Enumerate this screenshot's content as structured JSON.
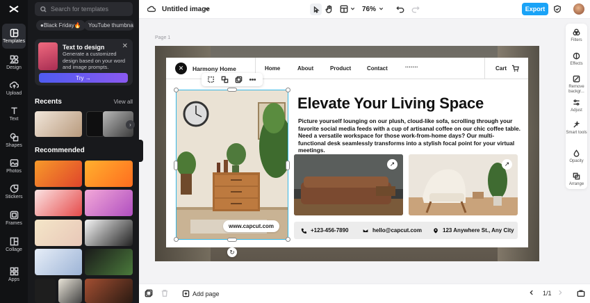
{
  "colors": {
    "accent": "#1aa3f7",
    "selection": "#35b7e6",
    "sidebar_bg": "#18191c",
    "rail_bg": "#111214"
  },
  "rail": {
    "items": [
      {
        "label": "Templates",
        "icon": "templates-icon"
      },
      {
        "label": "Design",
        "icon": "design-icon"
      },
      {
        "label": "Upload",
        "icon": "upload-icon"
      },
      {
        "label": "Text",
        "icon": "text-icon"
      },
      {
        "label": "Shapes",
        "icon": "shapes-icon"
      },
      {
        "label": "Photos",
        "icon": "photos-icon"
      },
      {
        "label": "Stickers",
        "icon": "stickers-icon"
      },
      {
        "label": "Frames",
        "icon": "frames-icon"
      },
      {
        "label": "Collage",
        "icon": "collage-icon"
      },
      {
        "label": "Apps",
        "icon": "apps-icon"
      }
    ]
  },
  "panel": {
    "search_placeholder": "Search for templates",
    "chips": [
      "●Black Friday🔥",
      "YouTube thumbna"
    ],
    "promo": {
      "title": "Text to design",
      "description": "Generate a customized design based on your word and image prompts.",
      "button": "Try →"
    },
    "recents_title": "Recents",
    "view_all": "View all",
    "recommended_title": "Recommended"
  },
  "topbar": {
    "doc_title": "Untitled image",
    "zoom": "76%",
    "export_label": "Export"
  },
  "canvas": {
    "page_label": "Page 1",
    "nav": {
      "brand": "Harmony Home",
      "links": [
        "Home",
        "About",
        "Product",
        "Contact",
        "·······"
      ],
      "cart": "Cart"
    },
    "headline": "Elevate Your Living Space",
    "body": "Picture yourself lounging on our plush, cloud-like sofa, scrolling through your favorite social media feeds with a cup of artisanal coffee on our chic coffee table. Need a versatile workspace for those work-from-home days? Our multi-functional desk seamlessly transforms into a stylish focal point for your virtual meetings.",
    "url": "www.capcut.com",
    "contacts": {
      "phone": "+123-456-7890",
      "email": "hello@capcut.com",
      "address": "123 Anywhere St., Any City"
    }
  },
  "tools": [
    {
      "label": "Filters",
      "icon": "filters-icon"
    },
    {
      "label": "Effects",
      "icon": "effects-icon"
    },
    {
      "label": "Remove backgr...",
      "icon": "remove-background-icon"
    },
    {
      "label": "Adjust",
      "icon": "adjust-icon"
    },
    {
      "label": "Smart tools",
      "icon": "smart-tools-icon"
    },
    {
      "label": "Opacity",
      "icon": "opacity-icon"
    },
    {
      "label": "Arrange",
      "icon": "arrange-icon"
    }
  ],
  "bottombar": {
    "add_page": "Add page",
    "pager": "1/1"
  }
}
